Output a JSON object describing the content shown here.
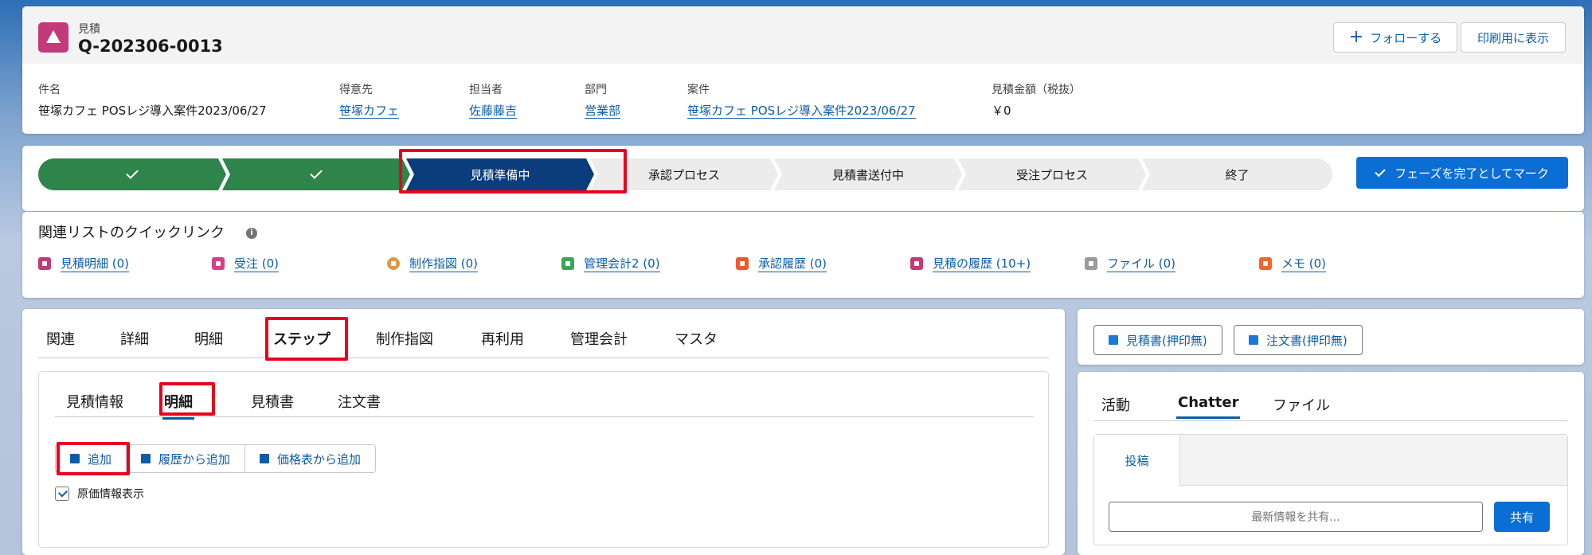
{
  "record": {
    "object_label": "見積",
    "name": "Q-202306-0013",
    "follow_label": "フォローする",
    "print_label": "印刷用に表示"
  },
  "fields": [
    {
      "label": "件名",
      "value": "笹塚カフェ POSレジ導入案件2023/06/27"
    },
    {
      "label": "得意先",
      "value": "笹塚カフェ"
    },
    {
      "label": "担当者",
      "value": "佐藤藤吉"
    },
    {
      "label": "部門",
      "value": "営業部"
    },
    {
      "label": "案件",
      "value": "笹塚カフェ POSレジ導入案件2023/06/27"
    },
    {
      "label": "見積金額（税抜）",
      "value": "￥0"
    }
  ],
  "path": {
    "steps": [
      "",
      "",
      "見積準備中",
      "承認プロセス",
      "見積書送付中",
      "受注プロセス",
      "終了"
    ],
    "current_index": 2,
    "mark_complete_label": "フェーズを完了としてマーク"
  },
  "quick_links": {
    "title": "関連リストのクイックリンク",
    "items": [
      {
        "label": "見積明細 (0)",
        "color": "#c23a78"
      },
      {
        "label": "受注 (0)",
        "color": "#d6408a"
      },
      {
        "label": "制作指図 (0)",
        "color": "#dd9b4a"
      },
      {
        "label": "管理会計2 (0)",
        "color": "#3ba755"
      },
      {
        "label": "承認履歴 (0)",
        "color": "#ee5a2d"
      },
      {
        "label": "見積の履歴 (10+)",
        "color": "#c23a78"
      },
      {
        "label": "ファイル (0)",
        "color": "#9a9a9a"
      },
      {
        "label": "メモ (0)",
        "color": "#f0662f"
      }
    ]
  },
  "main_tabs": [
    "関連",
    "詳細",
    "明細",
    "ステップ",
    "制作指図",
    "再利用",
    "管理会計",
    "マスタ"
  ],
  "sub_tabs": [
    "見積情報",
    "明細",
    "見積書",
    "注文書"
  ],
  "line_actions": {
    "add": "追加",
    "add_from_history": "履歴から追加",
    "add_from_pricebook": "価格表から追加"
  },
  "cost_checkbox_label": "原価情報表示",
  "right_buttons": [
    "見積書(押印無)",
    "注文書(押印無)"
  ],
  "feed": {
    "tabs": [
      "活動",
      "Chatter",
      "ファイル"
    ],
    "post_tab": "投稿",
    "share_placeholder": "最新情報を共有...",
    "share_button": "共有"
  }
}
